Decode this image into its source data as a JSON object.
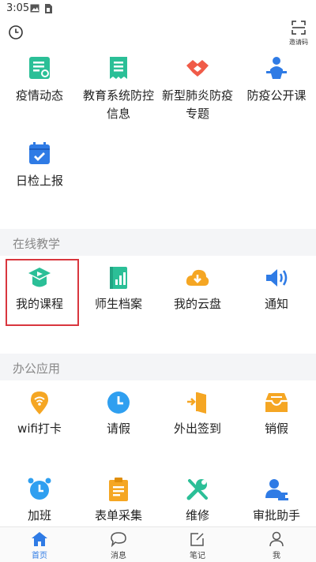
{
  "status_bar": {
    "time": "3:05"
  },
  "topbar": {
    "scan_label": "邀请码"
  },
  "top_grid": [
    {
      "label": "疫情动态"
    },
    {
      "label": "教育系统防控信息"
    },
    {
      "label": "新型肺炎防疫专题"
    },
    {
      "label": "防疫公开课"
    },
    {
      "label": "日检上报"
    }
  ],
  "online_teaching": {
    "title": "在线教学",
    "items": [
      {
        "label": "我的课程"
      },
      {
        "label": "师生档案"
      },
      {
        "label": "我的云盘"
      },
      {
        "label": "通知"
      }
    ]
  },
  "office": {
    "title": "办公应用",
    "items": [
      {
        "label": "wifi打卡"
      },
      {
        "label": "请假"
      },
      {
        "label": "外出签到"
      },
      {
        "label": "销假"
      },
      {
        "label": "加班"
      },
      {
        "label": "表单采集"
      },
      {
        "label": "维修"
      },
      {
        "label": "审批助手"
      }
    ]
  },
  "bottom_nav": [
    {
      "label": "首页"
    },
    {
      "label": "消息"
    },
    {
      "label": "笔记"
    },
    {
      "label": "我"
    }
  ],
  "colors": {
    "accent": "#2f7be5",
    "highlight": "#d9363e"
  }
}
